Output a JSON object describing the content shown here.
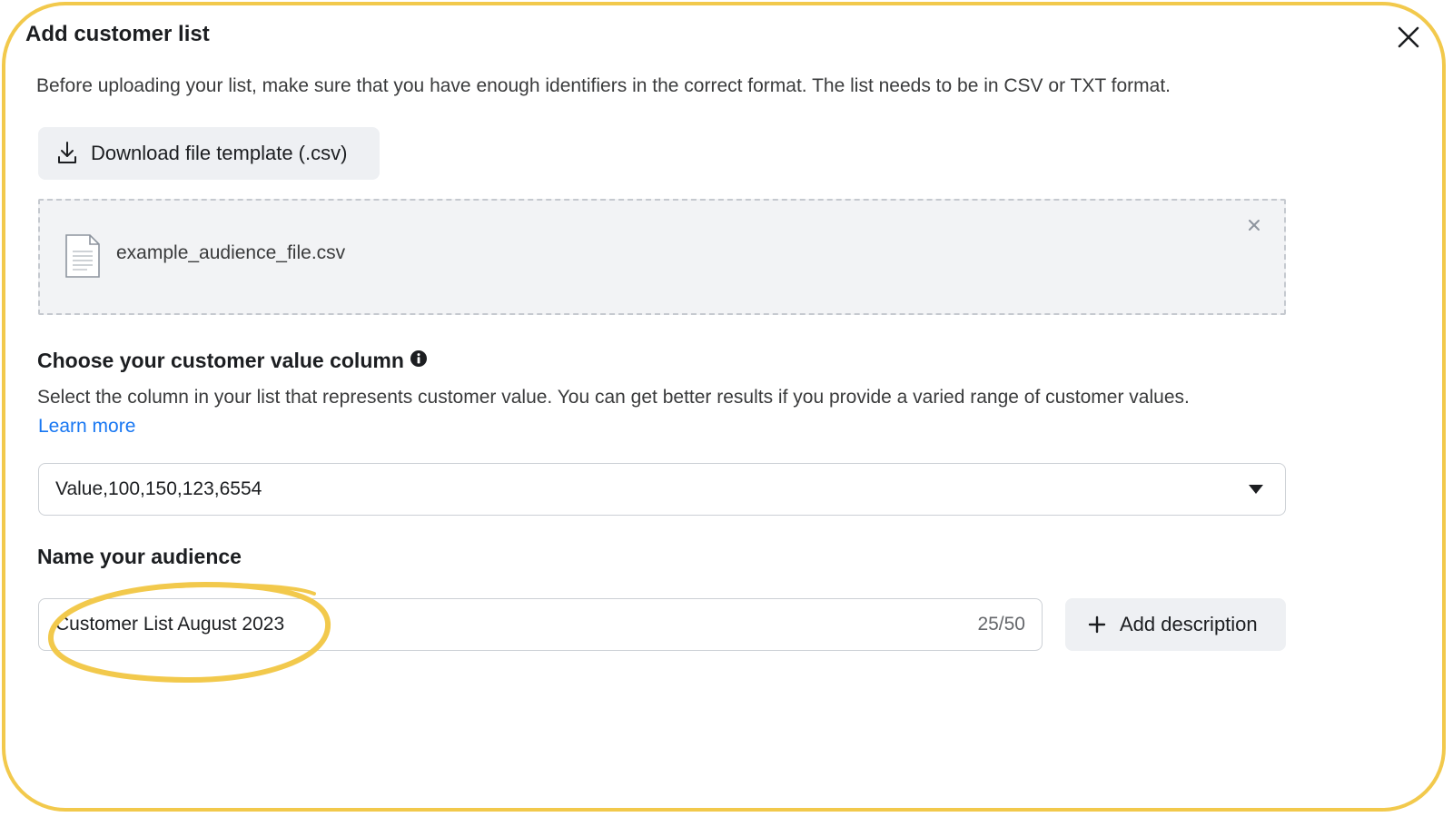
{
  "dialog": {
    "title": "Add customer list",
    "intro": "Before uploading your list, make sure that you have enough identifiers in the correct format. The list needs to be in CSV or TXT format.",
    "download_label": "Download file template (.csv)"
  },
  "upload": {
    "file_name": "example_audience_file.csv"
  },
  "value_column": {
    "heading": "Choose your customer value column",
    "description": "Select the column in your list that represents customer value. You can get better results if you provide a varied range of customer values.",
    "learn_more": "Learn more",
    "selected": "Value,100,150,123,6554"
  },
  "audience_name": {
    "heading": "Name your audience",
    "value": "Customer List August 2023",
    "counter": "25/50",
    "add_description_label": "Add description"
  },
  "colors": {
    "frame_highlight": "#f2c94c",
    "link": "#1877f2",
    "button_bg": "#eef0f3"
  },
  "icons": {
    "close": "close-icon",
    "download": "download-icon",
    "file": "file-icon",
    "remove": "remove-file-icon",
    "info": "info-icon",
    "dropdown": "chevron-down-icon",
    "plus": "plus-icon"
  }
}
